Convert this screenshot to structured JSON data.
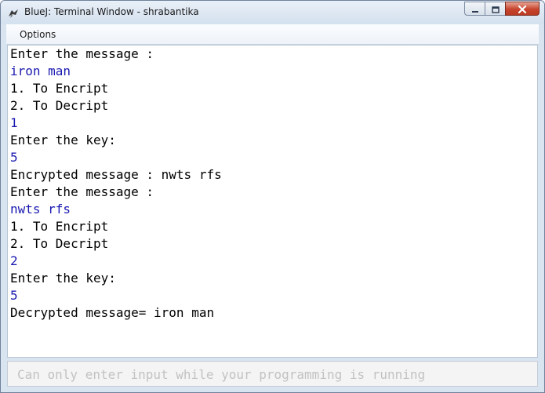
{
  "window": {
    "title": "BlueJ: Terminal Window - shrabantika"
  },
  "menubar": {
    "items": [
      {
        "label": "Options"
      }
    ]
  },
  "terminal": {
    "lines": [
      {
        "text": "Enter the message :",
        "kind": "output"
      },
      {
        "text": "iron man",
        "kind": "input"
      },
      {
        "text": "1. To Encript",
        "kind": "output"
      },
      {
        "text": "2. To Decript",
        "kind": "output"
      },
      {
        "text": "1",
        "kind": "input"
      },
      {
        "text": "Enter the key:",
        "kind": "output"
      },
      {
        "text": "5",
        "kind": "input"
      },
      {
        "text": "Encrypted message : nwts rfs",
        "kind": "output"
      },
      {
        "text": "Enter the message :",
        "kind": "output"
      },
      {
        "text": "nwts rfs",
        "kind": "input"
      },
      {
        "text": "1. To Encript",
        "kind": "output"
      },
      {
        "text": "2. To Decript",
        "kind": "output"
      },
      {
        "text": "2",
        "kind": "input"
      },
      {
        "text": "Enter the key:",
        "kind": "output"
      },
      {
        "text": "5",
        "kind": "input"
      },
      {
        "text": "Decrypted message= iron man",
        "kind": "output"
      }
    ]
  },
  "input": {
    "placeholder": "Can only enter input while your programming is running"
  },
  "colors": {
    "output_text": "#000000",
    "input_text": "#1a1ab0",
    "placeholder_text": "#c2c2c2"
  },
  "icons": {
    "app": "bluej-bird-icon",
    "minimize": "minimize-icon",
    "maximize": "maximize-icon",
    "close": "close-icon"
  }
}
